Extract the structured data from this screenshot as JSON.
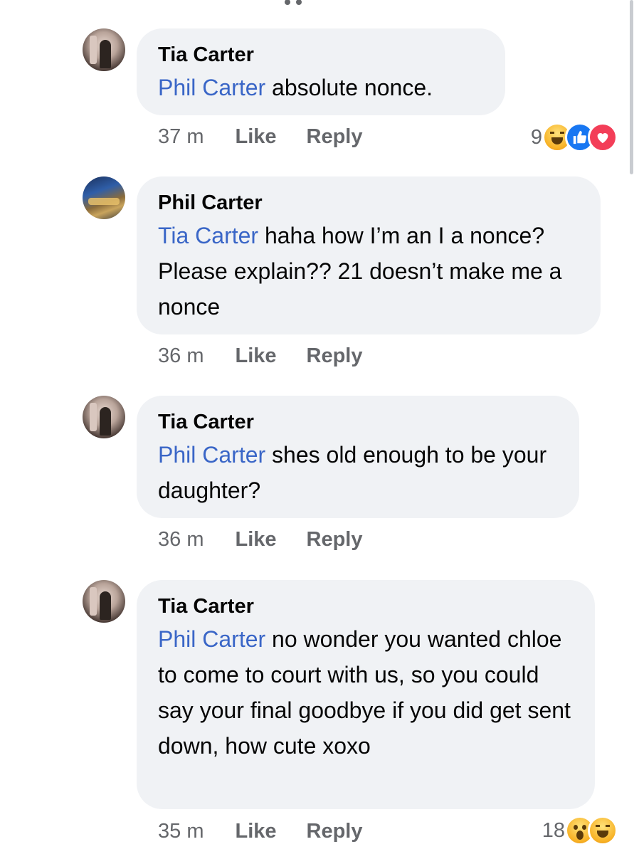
{
  "comments": [
    {
      "author": "Tia Carter",
      "mention": "Phil Carter",
      "text": " absolute nonce.",
      "time": "37 m",
      "like_label": "Like",
      "reply_label": "Reply",
      "reaction_count": "9",
      "reactions": [
        "haha-icon",
        "like-icon",
        "love-icon"
      ]
    },
    {
      "author": "Phil Carter",
      "mention": "Tia Carter",
      "text": " haha how I’m an I a nonce? Please explain?? 21 doesn’t make me a nonce",
      "time": "36 m",
      "like_label": "Like",
      "reply_label": "Reply"
    },
    {
      "author": "Tia Carter",
      "mention": "Phil Carter",
      "text": " shes old enough to be your daughter?",
      "time": "36 m",
      "like_label": "Like",
      "reply_label": "Reply"
    },
    {
      "author": "Tia Carter",
      "mention": "Phil Carter",
      "text": " no wonder you wanted chloe to come to court with us, so you could say your final goodbye if you did get sent down, how cute xoxo",
      "time": "35 m",
      "like_label": "Like",
      "reply_label": "Reply",
      "reaction_count": "18",
      "reactions": [
        "wow-icon",
        "haha-icon"
      ]
    }
  ],
  "colors": {
    "bubble": "#f0f2f5",
    "mention": "#3a66c7",
    "meta": "#65676b"
  }
}
